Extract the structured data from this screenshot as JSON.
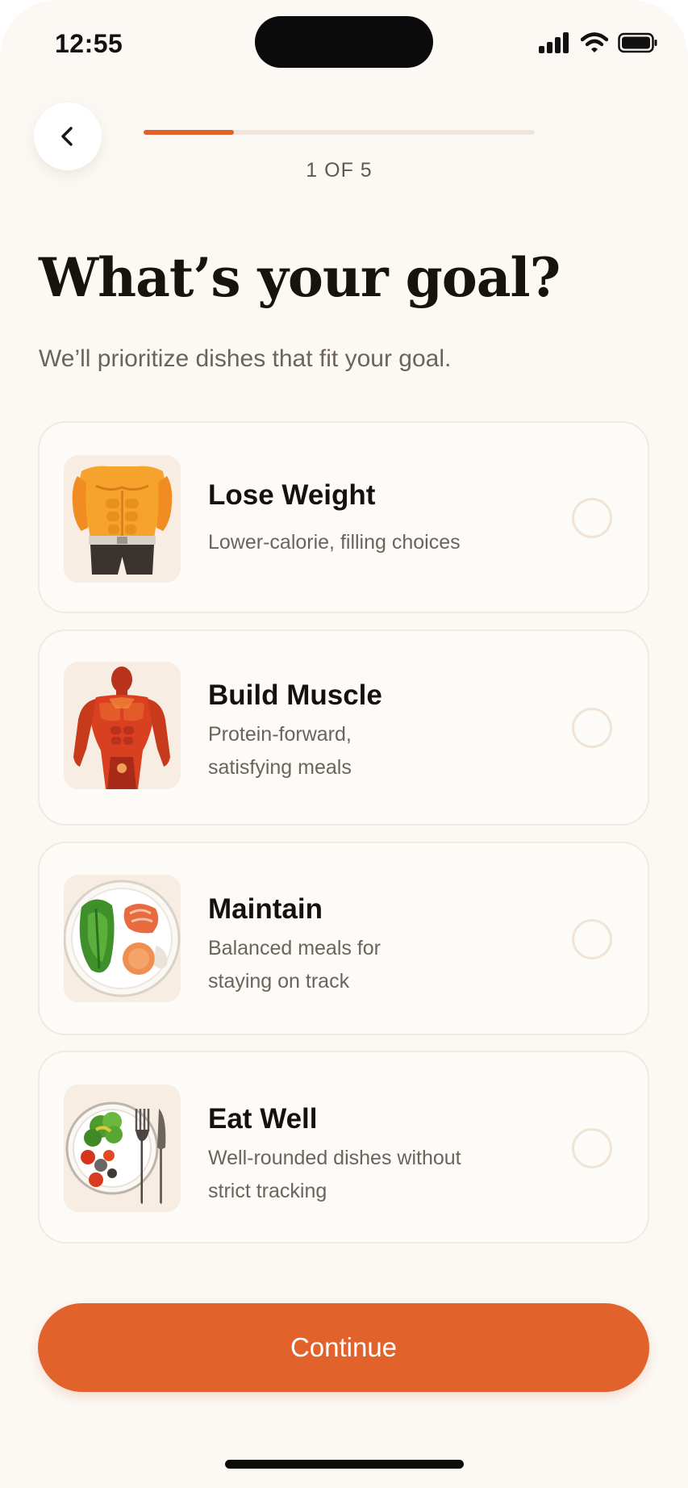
{
  "status_bar": {
    "time": "12:55"
  },
  "header": {
    "step_label": "1 OF 5",
    "progress": 0.2
  },
  "title": "What’s your goal?",
  "subtitle": "We’ll prioritize dishes that fit your goal.",
  "options": [
    {
      "title": "Lose Weight",
      "description": "Lower-calorie, filling choices",
      "selected": false,
      "icon": "torso-abs-icon"
    },
    {
      "title": "Build Muscle",
      "description": "Protein-forward, satisfying meals",
      "selected": false,
      "icon": "muscular-body-icon"
    },
    {
      "title": "Maintain",
      "description": "Balanced meals for staying on track",
      "selected": false,
      "icon": "balanced-plate-icon"
    },
    {
      "title": "Eat Well",
      "description": "Well-rounded dishes without strict tracking",
      "selected": false,
      "icon": "plate-with-cutlery-icon"
    }
  ],
  "continue_label": "Continue",
  "colors": {
    "accent": "#e1632b",
    "background": "#fcf9f5",
    "card_border": "#f2e9df",
    "thumb_bg": "#f7ede3"
  }
}
